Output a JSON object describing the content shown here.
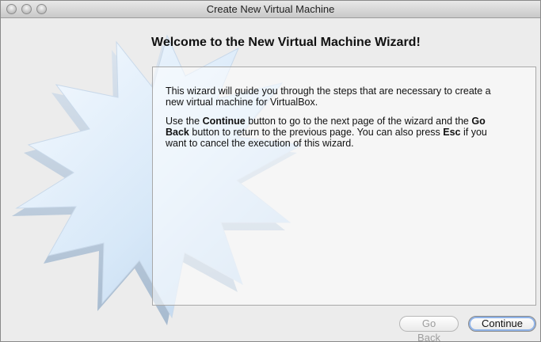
{
  "window": {
    "title": "Create New Virtual Machine"
  },
  "wizard": {
    "heading": "Welcome to the New Virtual Machine Wizard!",
    "para1": "This wizard will guide you through the steps that are necessary to create a new virtual machine for VirtualBox.",
    "para2": {
      "t1": "Use the ",
      "b1": "Continue",
      "t2": " button to go to the next page of the wizard and the ",
      "b2": "Go Back",
      "t3": " button to return to the previous page. You can also press ",
      "b3": "Esc",
      "t4": " if you want to cancel the execution of this wizard."
    }
  },
  "buttons": {
    "back": "Go Back",
    "continue": "Continue"
  },
  "colors": {
    "accent": "#8fb3e8",
    "star_light": "#f4f9ff",
    "star_blue": "#bcd6f0"
  }
}
